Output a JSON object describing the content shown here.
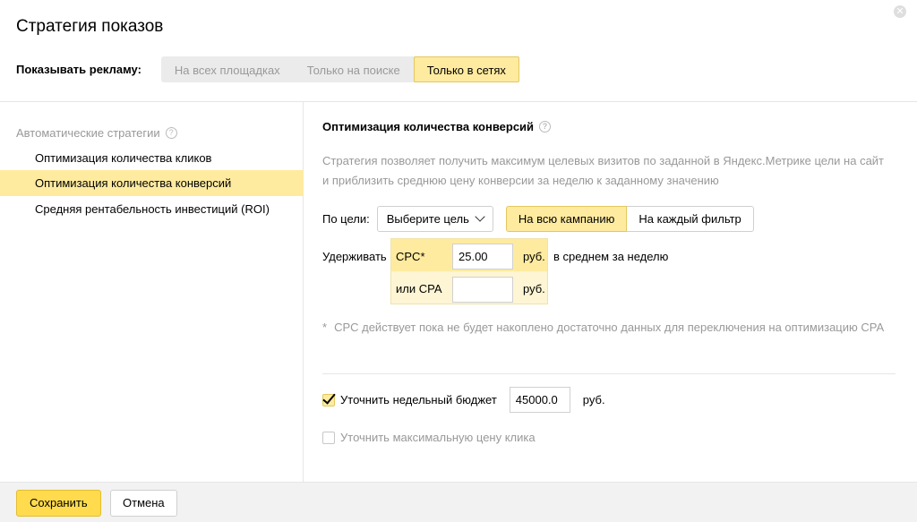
{
  "dialog": {
    "title": "Стратегия показов",
    "close_icon": "close-icon"
  },
  "show_ads": {
    "label": "Показывать рекламу:",
    "options": [
      "На всех площадках",
      "Только на поиске",
      "Только в сетях"
    ],
    "selected": "Только в сетях"
  },
  "sidebar": {
    "group_title": "Автоматические стратегии",
    "items": [
      {
        "label": "Оптимизация количества кликов",
        "active": false
      },
      {
        "label": "Оптимизация количества конверсий",
        "active": true
      },
      {
        "label": "Средняя рентабельность инвестиций (ROI)",
        "active": false
      }
    ]
  },
  "main": {
    "title": "Оптимизация количества конверсий",
    "description": "Стратегия позволяет получить максимум целевых визитов по заданной в Яндекс.Метрике цели на сайт и приблизить среднюю цену конверсии за неделю к заданному значению",
    "goal": {
      "label": "По цели:",
      "select_value": "Выберите цель",
      "scope_options": [
        "На всю кампанию",
        "На каждый фильтр"
      ],
      "scope_selected": "На всю кампанию"
    },
    "hold": {
      "label": "Удерживать",
      "cpc_label": "CPC*",
      "cpc_value": "25.00",
      "cpc_unit": "руб.",
      "cpc_suffix": "в среднем за неделю",
      "cpa_label": "или CPA",
      "cpa_value": "",
      "cpa_unit": "руб."
    },
    "footnote_star": "*",
    "footnote": "CPC действует пока не будет накоплено достаточно данных для переключения на оптимизацию CPA",
    "weekly_budget": {
      "checked": true,
      "label": "Уточнить недельный бюджет",
      "value": "45000.0",
      "unit": "руб."
    },
    "max_click_price": {
      "checked": false,
      "label": "Уточнить максимальную цену клика"
    }
  },
  "footer": {
    "save_label": "Сохранить",
    "cancel_label": "Отмена"
  },
  "colors": {
    "accent_yellow": "#ffeba0",
    "save_yellow": "#ffdb4d",
    "muted_text": "#999999"
  }
}
